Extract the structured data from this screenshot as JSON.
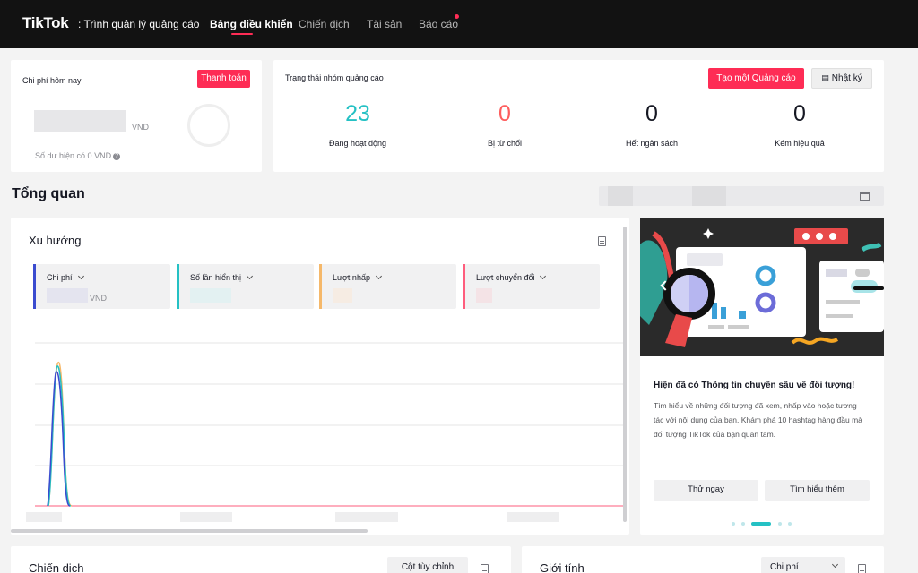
{
  "app": {
    "logo": "TikTok",
    "subtitle": ": Trình quản lý quảng cáo"
  },
  "nav": [
    {
      "label": "Bảng điều khiển"
    },
    {
      "label": "Chiến dịch"
    },
    {
      "label": "Tài sản"
    },
    {
      "label": "Báo cáo"
    }
  ],
  "spend": {
    "title": "Chi phí hôm nay",
    "pay_button": "Thanh toán",
    "currency": "VND",
    "balance": "Số dư hiện có 0 VND"
  },
  "status": {
    "title": "Trạng thái nhóm quảng cáo",
    "create_button": "Tạo một Quảng cáo",
    "log_button": "Nhật ký",
    "stats": [
      {
        "value": "23",
        "label": "Đang hoạt động",
        "color": "#25c1c4"
      },
      {
        "value": "0",
        "label": "Bị từ chối",
        "color": "#fe5d5d"
      },
      {
        "value": "0",
        "label": "Hết ngân sách",
        "color": "#161823"
      },
      {
        "value": "0",
        "label": "Kém hiệu quả",
        "color": "#161823"
      }
    ]
  },
  "overview": {
    "title": "Tổng quan"
  },
  "trend": {
    "title": "Xu hướng",
    "metrics": [
      {
        "label": "Chi phí",
        "unit": "VND",
        "color": "#3a4bcf"
      },
      {
        "label": "Số lần hiển thị",
        "unit": "",
        "color": "#25c1c4"
      },
      {
        "label": "Lượt nhấp",
        "unit": "",
        "color": "#f5b86a"
      },
      {
        "label": "Lượt chuyển đổi",
        "unit": "",
        "color": "#fe5d7d"
      }
    ]
  },
  "promo": {
    "title": "Hiện đã có Thông tin chuyên sâu về đối tượng!",
    "text": "Tìm hiểu về những đối tượng đã xem, nhấp vào hoặc tương tác với nội dung của bạn. Khám phá 10 hashtag hàng đầu mà đối tượng TikTok của bạn quan tâm.",
    "try_button": "Thử ngay",
    "learn_button": "Tìm hiểu thêm",
    "slide_count": 5,
    "active_slide": 3
  },
  "campaign": {
    "title": "Chiến dịch",
    "custom_columns_button": "Cột tùy chỉnh"
  },
  "gender": {
    "title": "Giới tính",
    "select_value": "Chi phí"
  },
  "colors": {
    "brand": "#fe2c55",
    "teal": "#25c1c4",
    "topbar": "#121212"
  }
}
